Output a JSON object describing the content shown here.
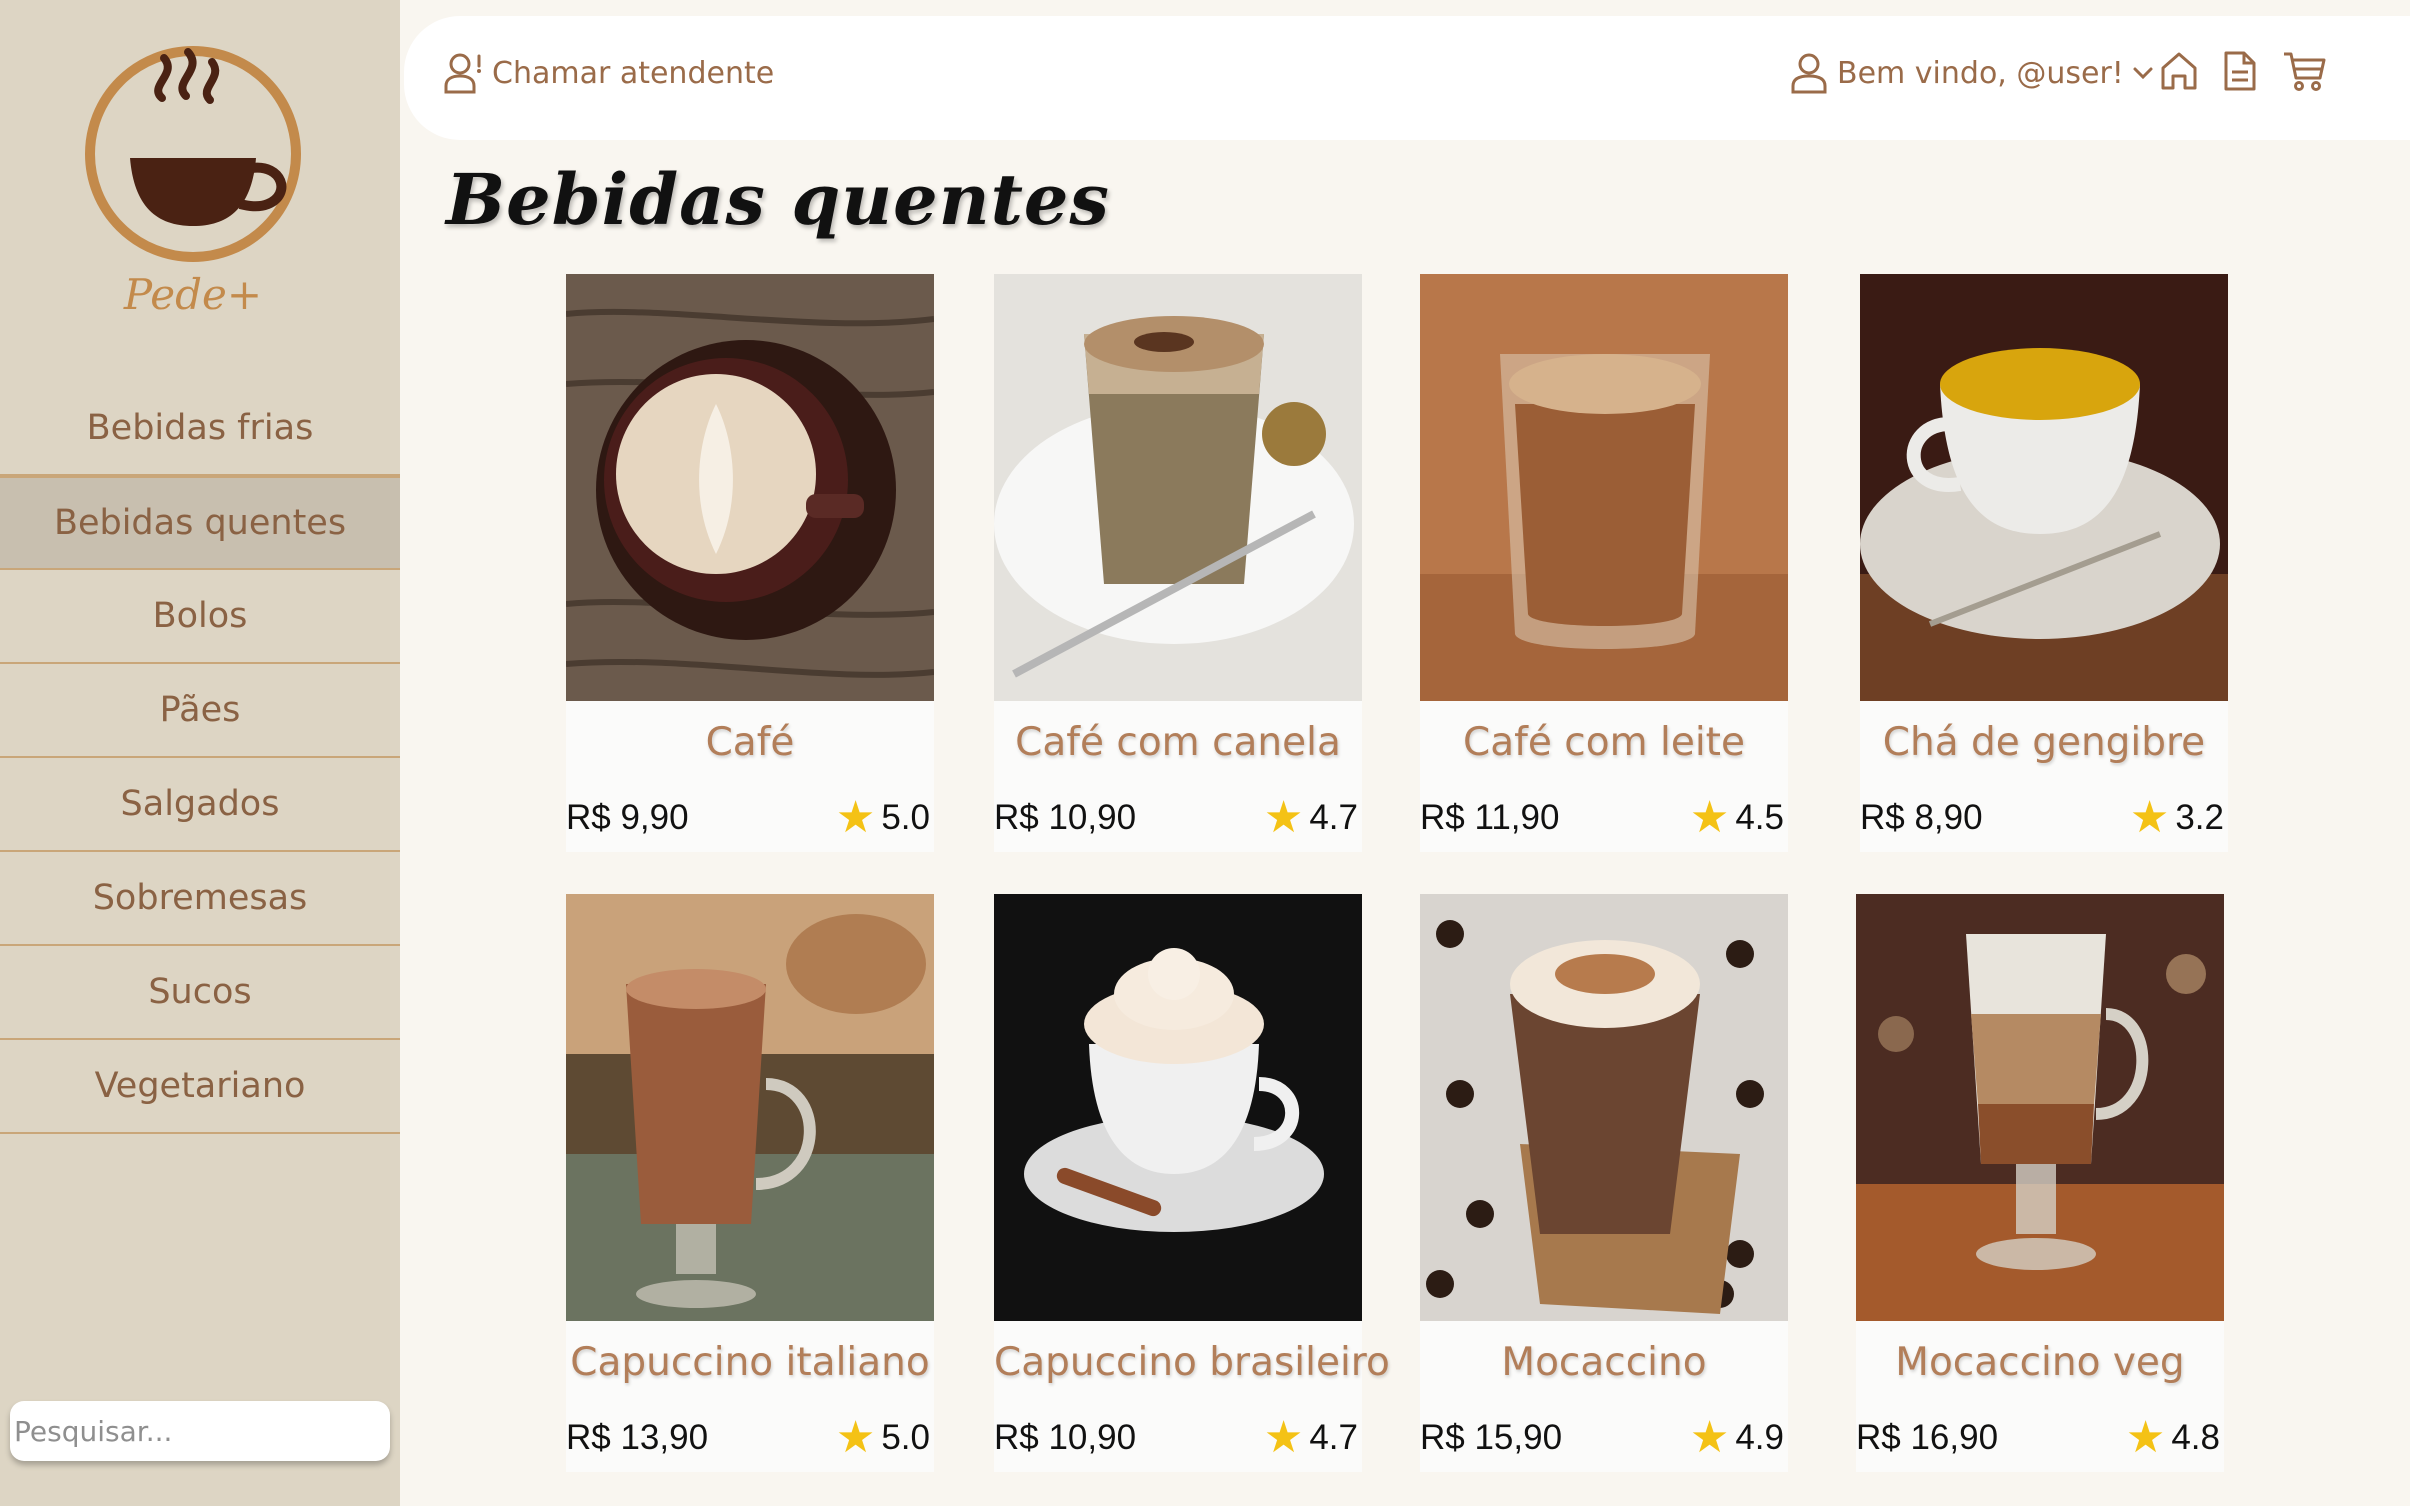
{
  "brand": {
    "name": "Pede+"
  },
  "sidebar": {
    "items": [
      {
        "label": "Bebidas frias",
        "active": false
      },
      {
        "label": "Bebidas quentes",
        "active": true
      },
      {
        "label": "Bolos",
        "active": false
      },
      {
        "label": "Pães",
        "active": false
      },
      {
        "label": "Salgados",
        "active": false
      },
      {
        "label": "Sobremesas",
        "active": false
      },
      {
        "label": "Sucos",
        "active": false
      },
      {
        "label": "Vegetariano",
        "active": false
      }
    ],
    "search_placeholder": "Pesquisar..."
  },
  "header": {
    "call_label": "Chamar atendente",
    "welcome_label": "Bem vindo, @user!",
    "icons": [
      "user-alert-icon",
      "user-icon",
      "chevron-down-icon",
      "home-icon",
      "document-icon",
      "cart-icon"
    ]
  },
  "page": {
    "title": "Bebidas quentes"
  },
  "products": [
    {
      "name": "Café",
      "price": "R$ 9,90",
      "rating": "5.0"
    },
    {
      "name": "Café com canela",
      "price": "R$ 10,90",
      "rating": "4.7"
    },
    {
      "name": "Café com leite",
      "price": "R$ 11,90",
      "rating": "4.5"
    },
    {
      "name": "Chá de gengibre",
      "price": "R$ 8,90",
      "rating": "3.2"
    },
    {
      "name": "Capuccino italiano",
      "price": "R$ 13,90",
      "rating": "5.0"
    },
    {
      "name": "Capuccino brasileiro",
      "price": "R$ 10,90",
      "rating": "4.7"
    },
    {
      "name": "Mocaccino",
      "price": "R$ 15,90",
      "rating": "4.9"
    },
    {
      "name": "Mocaccino veg",
      "price": "R$ 16,90",
      "rating": "4.8"
    }
  ],
  "colors": {
    "sidebar_bg": "#ddd5c4",
    "sidebar_active": "#c8bfaf",
    "accent_brown": "#9a6b49",
    "product_name": "#b27e59",
    "star": "#f4c215",
    "logo_ring": "#c38a4b",
    "logo_cup": "#4a2213"
  }
}
